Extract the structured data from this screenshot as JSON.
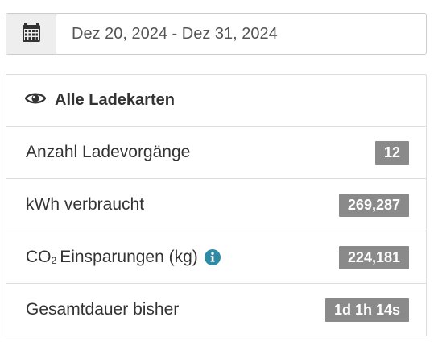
{
  "date_filter": {
    "icon": "calendar-icon",
    "range_text": "Dez 20, 2024 - Dez 31, 2024"
  },
  "panel": {
    "icon": "eye-icon",
    "title": "Alle Ladekarten",
    "rows": [
      {
        "label": "Anzahl Ladevorgänge",
        "value": "12"
      },
      {
        "label": "kWh verbraucht",
        "value": "269,287"
      },
      {
        "label_main": "CO",
        "label_sub": "2",
        "label_rest": "Einsparungen (kg)",
        "info_icon": "info-circle-icon",
        "value": "224,181"
      },
      {
        "label": "Gesamtdauer bisher",
        "value": "1d 1h 14s"
      }
    ]
  },
  "colors": {
    "badge_bg": "#8a8a8a",
    "info_icon": "#2e8ba5",
    "addon_bg": "#eeeeee"
  }
}
